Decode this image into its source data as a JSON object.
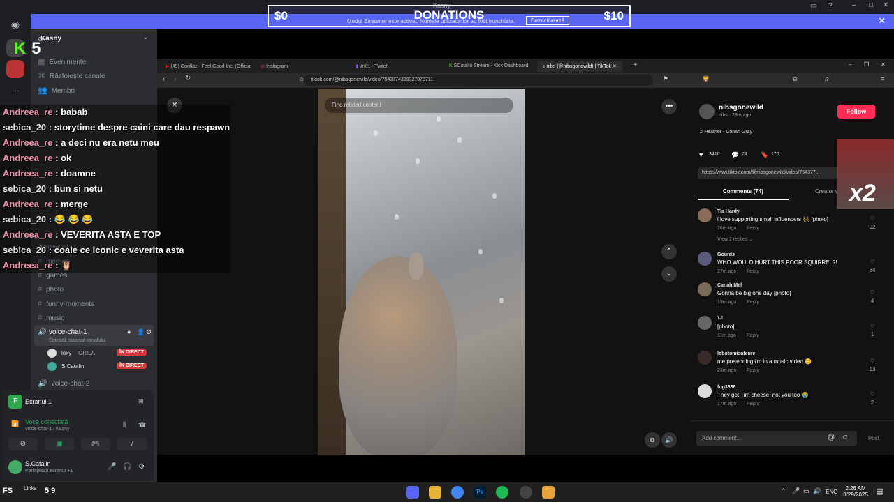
{
  "window": {
    "title": "Kasny"
  },
  "donations": {
    "left": "$0",
    "title": "DONATIONS",
    "right": "$10",
    "notice": "Modul Streamer este activat. Numele utilizatorilor au fost trunchiate.",
    "button": "Dezactivează"
  },
  "logo": {
    "letter": "K",
    "number": "5"
  },
  "server": {
    "name": "Kasny"
  },
  "sidebar": {
    "top_items": [
      "Evenimente",
      "Răsfoiește canale",
      "Membri"
    ],
    "channels": [
      "memes",
      "games",
      "photo",
      "funny-moments",
      "music"
    ],
    "hidden_channel": "diverse-chat",
    "voice_channels": [
      {
        "name": "voice-chat-1",
        "status": "Setează statusul canalului",
        "users": [
          {
            "name": "loxy",
            "extra": "GRILA",
            "badge": "ÎN DIRECT"
          },
          {
            "name": "S.Catalin",
            "extra": "",
            "badge": "ÎN DIRECT"
          }
        ]
      },
      {
        "name": "voice-chat-2"
      }
    ]
  },
  "voice_panel": {
    "screen_title": "Ecranul 1",
    "connected": "Voce conectată",
    "connected_sub": "voice-chat-1 / Kasny",
    "user": "S.Catalin",
    "user_sub": "Partajează ecranul +1"
  },
  "chat": [
    {
      "user": "Andreea_re",
      "msg": "babab",
      "color": "#ef8fa6"
    },
    {
      "user": "sebica_20",
      "msg": "storytime despre caini care dau respawn",
      "color": "#e4e4e4"
    },
    {
      "user": "Andreea_re",
      "msg": "a deci nu era netu meu",
      "color": "#ef8fa6"
    },
    {
      "user": "Andreea_re",
      "msg": "ok",
      "color": "#ef8fa6"
    },
    {
      "user": "Andreea_re",
      "msg": "doamne",
      "color": "#ef8fa6"
    },
    {
      "user": "sebica_20",
      "msg": "bun si netu",
      "color": "#e4e4e4"
    },
    {
      "user": "Andreea_re",
      "msg": "merge",
      "color": "#ef8fa6"
    },
    {
      "user": "sebica_20",
      "msg": "😂 😂 😂",
      "color": "#e4e4e4"
    },
    {
      "user": "Andreea_re",
      "msg": "VEVERITA ASTA E TOP",
      "color": "#ef8fa6"
    },
    {
      "user": "sebica_20",
      "msg": "coaie ce iconic e veverita asta",
      "color": "#e4e4e4"
    },
    {
      "user": "Andreea_re",
      "msg": "🦉",
      "color": "#ef8fa6"
    }
  ],
  "browser": {
    "tabs": [
      "(49) Gorillaz - Feel Good Inc. (Officia",
      "Instagram",
      "\\m01 - Twitch",
      "SCatalin Stream - Kick Dashboard",
      "nibs (@nibsgonewild) | TikTok"
    ],
    "url": "tiktok.com/@nibsgonewild/video/7543774329327078711",
    "search_placeholder": "Find related content"
  },
  "tiktok": {
    "author": "nibsgonewild",
    "author_sub": "nibs · 29m ago",
    "follow": "Follow",
    "music": "♫ Heather - Conan Gray",
    "stats": {
      "likes": "3410",
      "comments": "74",
      "saves": "176"
    },
    "link": "https://www.tiktok.com/@nibsgonewild/video/754377...",
    "tab_comments": "Comments (74)",
    "tab_creator": "Creator v",
    "comments": [
      {
        "name": "Tia Hardy",
        "text": "i love supporting small influencers 👯 [photo]",
        "time": "26m ago",
        "reply": "Reply",
        "likes": "92",
        "extra": "View 2 replies ⌄"
      },
      {
        "name": "Gourds",
        "text": "WHO WOULD HURT THIS POOR SQUIRREL?!",
        "time": "27m ago",
        "reply": "Reply",
        "likes": "84"
      },
      {
        "name": "Car.ah.Mel",
        "text": "Gonna be big one day [photo]",
        "time": "19m ago",
        "reply": "Reply",
        "likes": "4"
      },
      {
        "name": "ᵀ-ᵀ",
        "text": "[photo]",
        "time": "11m ago",
        "reply": "Reply",
        "likes": "1"
      },
      {
        "name": "lobotomisateure",
        "text": "me pretending i'm in a music video 😊",
        "time": "23m ago",
        "reply": "Reply",
        "likes": "13"
      },
      {
        "name": "fog3336",
        "text": "They got Tim cheese, not you too 😭",
        "time": "17m ago",
        "reply": "Reply",
        "likes": "2"
      }
    ],
    "add_comment": "Add comment...",
    "post": "Post"
  },
  "badge": {
    "text": "x2"
  },
  "taskbar": {
    "left_text": "Links",
    "left_num": "5 9",
    "lang": "ENG",
    "time": "2:26 AM",
    "date": "8/29/2025"
  },
  "colors": {
    "discord_bg": "#1e1f22",
    "accent": "#5865f2",
    "tiktok_red": "#fe2c55",
    "kick_green": "#53fc18"
  }
}
